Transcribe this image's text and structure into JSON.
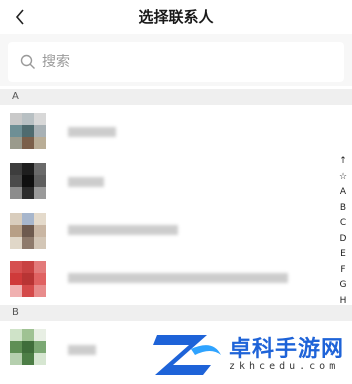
{
  "header": {
    "title": "选择联系人",
    "back_icon": "chevron-left-icon"
  },
  "search": {
    "placeholder": "搜索",
    "icon": "search-icon"
  },
  "sections": [
    {
      "letter": "A"
    },
    {
      "letter": "B"
    }
  ],
  "index_bar": [
    "↑",
    "☆",
    "A",
    "B",
    "C",
    "D",
    "E",
    "F",
    "G",
    "H"
  ],
  "contacts": [
    {
      "section": "A",
      "name_hidden": true,
      "avatar_colors": [
        "#c9c9c9",
        "#b8c0c3",
        "#d8d8d8",
        "#6e8f95",
        "#4f6b6f",
        "#a8b1b5",
        "#9a9a8c",
        "#7b5f4a",
        "#b9ad96"
      ]
    },
    {
      "section": "A",
      "name_hidden": true,
      "avatar_colors": [
        "#3d3d3d",
        "#1e1e1e",
        "#6a6a6a",
        "#4a4a4a",
        "#0f0f0f",
        "#5f5f5f",
        "#8c8c8c",
        "#2b2b2b",
        "#9a9a9a"
      ]
    },
    {
      "section": "A",
      "name_hidden": true,
      "avatar_colors": [
        "#d9cdbd",
        "#a7b6cc",
        "#e4dacb",
        "#b79f86",
        "#6e5a4e",
        "#c9b6a3",
        "#e0d7c8",
        "#8e7a6b",
        "#d3c6b6"
      ]
    },
    {
      "section": "A",
      "name_hidden": true,
      "avatar_colors": [
        "#d65050",
        "#c84242",
        "#e37a7a",
        "#cf3a3a",
        "#b83434",
        "#e06262",
        "#f0b0b0",
        "#d44a4a",
        "#e88c8c"
      ]
    },
    {
      "section": "B",
      "name_hidden": true,
      "avatar_colors": [
        "#cfe3c8",
        "#9fc293",
        "#e8efe4",
        "#5f8f55",
        "#3f6d3a",
        "#7ba873",
        "#b5cfae",
        "#4d7e46",
        "#d6e6d1"
      ]
    }
  ],
  "watermark": {
    "title": "卓科手游网",
    "domain": "zkhcedu.com"
  }
}
